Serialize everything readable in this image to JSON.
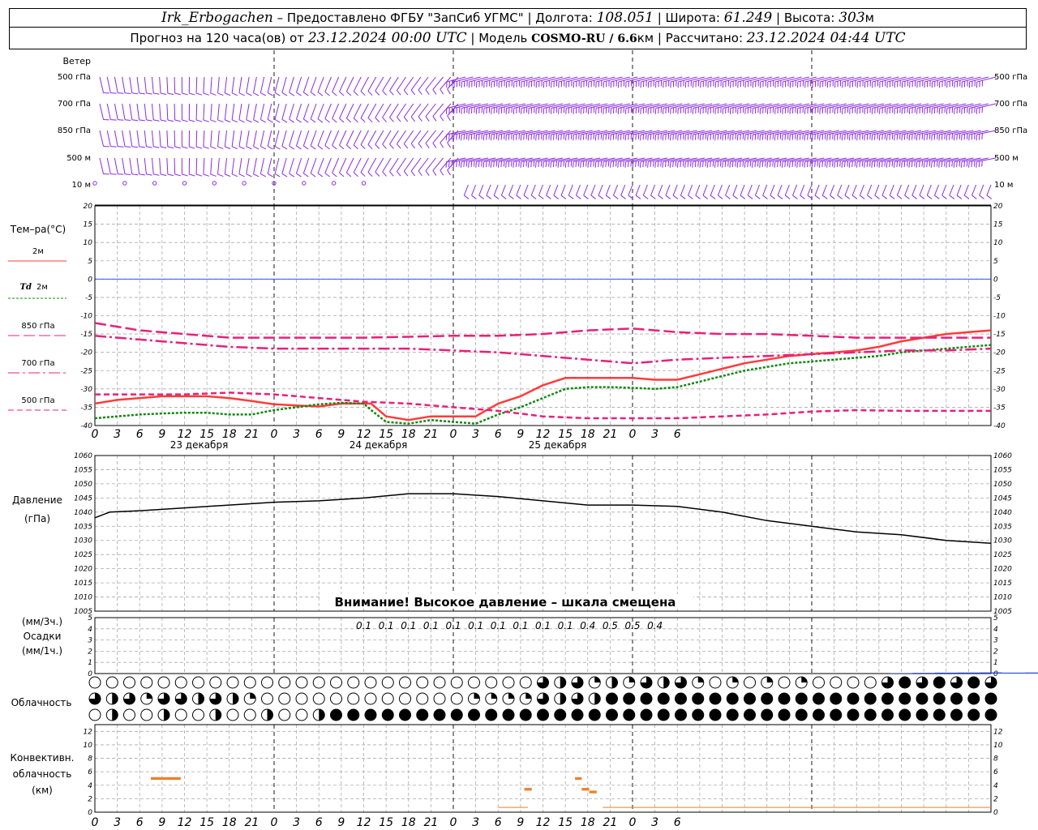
{
  "header": {
    "station": "Irk_Erbogachen",
    "provider": "– Предоставлено ФГБУ \"ЗапСиб УГМС\"",
    "lon_label": "| Долгота:",
    "lon": "108.051",
    "lat_label": "| Широта:",
    "lat": "61.249",
    "alt_label": "| Высота:",
    "alt": "303",
    "alt_unit": "м",
    "forecast_label": "Прогноз на 120 часа(ов) от",
    "forecast_from": "23.12.2024 00:00 UTC",
    "model_label": "| Модель",
    "model": "COSMO-RU / 6.6",
    "model_unit": "км",
    "calc_label": "| Рассчитано:",
    "calc_time": "23.12.2024 04:44 UTC"
  },
  "colors": {
    "wind": "#8a2be2",
    "t2m": "#ff3b3b",
    "td2m": "#118811",
    "t850": "#e8207a",
    "t700": "#e8207a",
    "t500": "#e8207a",
    "zero": "#3355ff",
    "precip": "#2244dd",
    "conv": "#f07f2a"
  },
  "x_ticks": [
    "0",
    "3",
    "6",
    "9",
    "12",
    "15",
    "18",
    "21",
    "0",
    "3",
    "6",
    "9",
    "12",
    "15",
    "18",
    "21",
    "0",
    "3",
    "6",
    "9",
    "12",
    "15",
    "18",
    "21",
    "0",
    "3",
    "6"
  ],
  "days": [
    "23 декабря",
    "24 декабря",
    "25 декабря"
  ],
  "chart_data": [
    {
      "type": "barbs",
      "name": "wind",
      "row_label": "Ветер",
      "levels": [
        "500 гПа",
        "700 гПа",
        "850 гПа",
        "500 м",
        "10 м"
      ]
    },
    {
      "type": "line",
      "name": "temperature",
      "ylabel": "Тем–ра(°С)",
      "ylim": [
        -40,
        20
      ],
      "yticks": [
        20,
        15,
        10,
        5,
        0,
        -5,
        -10,
        -15,
        -20,
        -25,
        -30,
        -35,
        -40
      ],
      "series": [
        {
          "name": "2м",
          "key": "t2m",
          "style": "solid",
          "width": 2.5,
          "x": [
            0,
            3,
            6,
            9,
            12,
            15,
            18,
            21,
            24,
            27,
            30,
            33,
            36,
            37,
            39,
            42,
            45,
            48,
            51,
            54,
            57,
            60,
            63,
            66,
            69,
            72,
            75,
            78,
            81,
            84,
            87,
            90,
            93,
            96,
            99,
            102,
            105,
            108,
            111,
            114,
            117,
            120
          ],
          "y": [
            -34,
            -33,
            -32.5,
            -32,
            -32,
            -32,
            -32.5,
            -33.3,
            -34.2,
            -34.5,
            -34.8,
            -34,
            -34,
            -34,
            -37.5,
            -38.5,
            -37.5,
            -37.5,
            -37.5,
            -34,
            -32,
            -29,
            -27,
            -27,
            -27,
            -27,
            -27.5,
            -27.5,
            -26,
            -24.5,
            -23,
            -22,
            -21,
            -20.5,
            -20,
            -19.5,
            -18.5,
            -17,
            -16,
            -15,
            -14.5,
            -14
          ]
        },
        {
          "name": "Td",
          "name_sub": "2м",
          "key": "td2m",
          "style": "dotted",
          "width": 2.5,
          "x": [
            0,
            3,
            6,
            9,
            12,
            15,
            18,
            21,
            24,
            27,
            30,
            33,
            36,
            37,
            39,
            42,
            45,
            48,
            51,
            54,
            57,
            60,
            63,
            66,
            69,
            72,
            75,
            78,
            81,
            84,
            87,
            90,
            93,
            96,
            99,
            102,
            105,
            108,
            111,
            114,
            117,
            120
          ],
          "y": [
            -38,
            -37.5,
            -37,
            -36.7,
            -36.5,
            -36.5,
            -37,
            -37,
            -35.8,
            -35,
            -34.2,
            -33.8,
            -34,
            -35.8,
            -39,
            -39.5,
            -38.5,
            -39,
            -39.5,
            -37,
            -35,
            -32.5,
            -30,
            -29.5,
            -29.5,
            -29.7,
            -30,
            -29.5,
            -28,
            -26.5,
            -25,
            -24,
            -23,
            -22.5,
            -22,
            -21.5,
            -21,
            -20,
            -19.5,
            -19,
            -18.5,
            -18
          ]
        },
        {
          "name": "850 гПа",
          "key": "t850",
          "style": "longdash",
          "width": 2.5,
          "x": [
            0,
            6,
            12,
            18,
            24,
            36,
            48,
            54,
            60,
            66,
            72,
            78,
            84,
            90,
            96,
            102,
            108,
            114,
            120
          ],
          "y": [
            -12,
            -14,
            -15,
            -16,
            -16,
            -16,
            -15.5,
            -15.5,
            -15,
            -14,
            -13.5,
            -14.5,
            -15,
            -15,
            -15.5,
            -16,
            -16,
            -16,
            -16
          ]
        },
        {
          "name": "700 гПа",
          "key": "t700",
          "style": "dashdot",
          "width": 2.5,
          "x": [
            0,
            6,
            12,
            18,
            24,
            30,
            36,
            42,
            48,
            54,
            60,
            66,
            72,
            78,
            84,
            90,
            96,
            102,
            108,
            114,
            120
          ],
          "y": [
            -15.5,
            -16.5,
            -17.5,
            -18.5,
            -19,
            -19,
            -19,
            -19,
            -19.5,
            -20,
            -21,
            -22,
            -23,
            -22,
            -21.5,
            -21,
            -20.5,
            -20,
            -19.5,
            -19.5,
            -19
          ]
        },
        {
          "name": "500 гПа",
          "key": "t500",
          "style": "dashed",
          "width": 2.5,
          "x": [
            0,
            6,
            12,
            18,
            24,
            30,
            36,
            42,
            48,
            54,
            60,
            66,
            72,
            78,
            84,
            90,
            96,
            102,
            108,
            114,
            120
          ],
          "y": [
            -31.5,
            -31.5,
            -31.5,
            -31,
            -31.5,
            -32.5,
            -33.5,
            -34,
            -35,
            -36,
            -37.5,
            -38,
            -38,
            -38,
            -37.5,
            -37,
            -36.2,
            -35.8,
            -36,
            -36,
            -36
          ]
        }
      ]
    },
    {
      "type": "line",
      "name": "pressure",
      "ylabel": "Давление",
      "ylabel2": "(гПа)",
      "ylim": [
        1005,
        1060
      ],
      "yticks": [
        1060,
        1055,
        1050,
        1045,
        1040,
        1035,
        1030,
        1025,
        1020,
        1015,
        1010,
        1005
      ],
      "note": "Внимание! Высокое давление – шкала смещена",
      "series": [
        {
          "name": "pressure",
          "key": "pressure",
          "x": [
            0,
            2,
            6,
            12,
            18,
            24,
            30,
            36,
            42,
            48,
            54,
            60,
            66,
            72,
            78,
            84,
            90,
            96,
            102,
            108,
            114,
            120
          ],
          "y": [
            1038,
            1040,
            1040.5,
            1041.5,
            1042.5,
            1043.5,
            1044,
            1045,
            1046.5,
            1046.5,
            1045.5,
            1044,
            1042.5,
            1042.5,
            1042,
            1040,
            1037,
            1035,
            1033,
            1032,
            1030,
            1029
          ]
        }
      ]
    },
    {
      "type": "bar",
      "name": "precipitation",
      "ylabel_top": "(мм/3ч.)",
      "ylabel": "Осадки",
      "ylabel_bottom": "(мм/1ч.)",
      "ylim": [
        0,
        5
      ],
      "yticks": [
        5,
        4,
        3,
        2,
        1,
        0
      ],
      "labels_x": [
        36,
        39,
        42,
        45,
        48,
        51,
        54,
        57,
        60,
        63,
        66,
        69,
        72,
        75
      ],
      "labels": [
        "0.1",
        "0.1",
        "0.1",
        "0.1",
        "0.1",
        "0.1",
        "0.1",
        "0.1",
        "0.1",
        "0.1",
        "0.4",
        "0.5",
        "0.5",
        "0.4"
      ],
      "x": [
        36,
        37,
        38,
        39,
        40,
        41,
        42,
        43,
        44,
        45,
        46,
        47,
        48,
        49,
        50,
        51,
        52,
        53,
        54,
        55,
        56,
        57,
        58,
        59,
        60,
        61,
        62,
        63,
        64,
        65,
        66,
        67,
        68,
        69,
        70,
        71,
        72,
        73,
        74,
        75
      ],
      "y": [
        0.03,
        0.06,
        0.08,
        0.09,
        0.1,
        0.08,
        0.09,
        0.1,
        0.06,
        0.08,
        0.05,
        0.07,
        0.04,
        0.05,
        0.05,
        0.04,
        0.05,
        0.06,
        0.04,
        0.05,
        0.03,
        0.05,
        0.04,
        0.05,
        0.05,
        0.08,
        0.12,
        0.2,
        0.25,
        0.3,
        0.35,
        0.4,
        0.35,
        0.4,
        0.45,
        0.4,
        0.45,
        0.4,
        0.35,
        0.3
      ]
    },
    {
      "type": "table",
      "name": "cloudiness",
      "row_label": "Облачность",
      "rows": 3
    },
    {
      "type": "bar",
      "name": "convective-cloudiness",
      "ylabel": "Конвективн.",
      "ylabel2": "облачность",
      "ylabel3": "(км)",
      "ylim": [
        0,
        13
      ],
      "yticks": [
        12,
        10,
        8,
        6,
        4,
        2,
        0
      ],
      "segments": [
        {
          "x0": 7.5,
          "x1": 11.5,
          "bottom": 4.8,
          "top": 5.2
        },
        {
          "x0": 57.5,
          "x1": 58.5,
          "bottom": 3.2,
          "top": 3.6
        },
        {
          "x0": 64.3,
          "x1": 65.2,
          "bottom": 4.8,
          "top": 5.2
        },
        {
          "x0": 65.2,
          "x1": 66.2,
          "bottom": 3.2,
          "top": 3.6
        },
        {
          "x0": 66.2,
          "x1": 67.2,
          "bottom": 2.8,
          "top": 3.2
        }
      ],
      "lines": [
        {
          "x0": 54,
          "x1": 58,
          "y": 0.7
        },
        {
          "x0": 68,
          "x1": 120,
          "y": 0.7
        }
      ]
    }
  ]
}
